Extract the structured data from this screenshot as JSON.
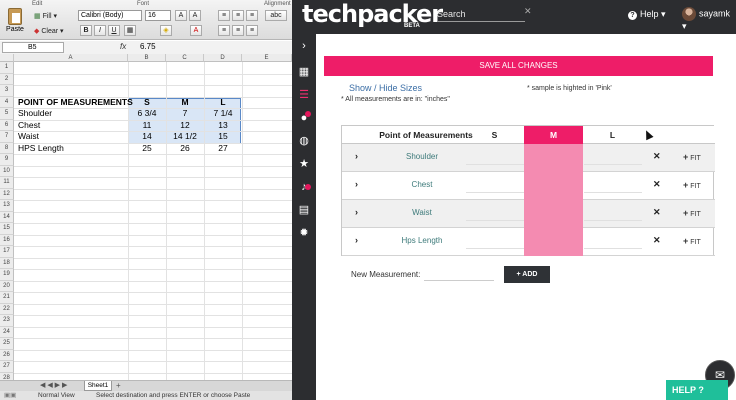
{
  "excel": {
    "ribbon": {
      "edit_label": "Edit",
      "font_label": "Font",
      "alignment_label": "Alignment",
      "paste_label": "Paste",
      "fill_label": "Fill",
      "clear_label": "Clear",
      "font_name": "Calibri (Body)",
      "font_size": "16",
      "wrap_label": "abc"
    },
    "formula_bar": {
      "name_box": "B5",
      "fx": "fx",
      "value": "6.75"
    },
    "columns": [
      "A",
      "B",
      "C",
      "D",
      "E"
    ],
    "rows": [
      "1",
      "2",
      "3",
      "4",
      "5",
      "6",
      "7",
      "8",
      "9",
      "10",
      "11",
      "12",
      "13",
      "14",
      "15",
      "16",
      "17",
      "18",
      "19",
      "20",
      "21",
      "22",
      "23",
      "24",
      "25",
      "26",
      "27",
      "28"
    ],
    "header": {
      "label": "POINT OF MEASUREMENTS",
      "sizes": [
        "S",
        "M",
        "L"
      ]
    },
    "data_rows": [
      {
        "label": "Shoulder",
        "values": [
          "6 3/4",
          "7",
          "7 1/4"
        ]
      },
      {
        "label": "Chest",
        "values": [
          "11",
          "12",
          "13"
        ]
      },
      {
        "label": "Waist",
        "values": [
          "14",
          "14 1/2",
          "15"
        ]
      },
      {
        "label": "HPS Length",
        "values": [
          "25",
          "26",
          "27"
        ]
      }
    ],
    "sheet_tab": "Sheet1",
    "status": {
      "view": "Normal View",
      "message": "Select destination and press ENTER or choose Paste"
    }
  },
  "app": {
    "logo": "techpacker",
    "beta": "BETA",
    "search_placeholder": "Search",
    "search_clear": "✕",
    "help_label": "Help ▾",
    "user_name": "sayamk ▾",
    "save_button": "SAVE ALL CHANGES",
    "show_hide": "Show / Hide Sizes",
    "note_inches": "* All measurements are in: \"inches\"",
    "note_sample": "* sample is highted in 'Pink'",
    "table_headers": [
      "Point of Measurements",
      "S",
      "M",
      "L"
    ],
    "rows": [
      {
        "label": "Shoulder"
      },
      {
        "label": "Chest"
      },
      {
        "label": "Waist"
      },
      {
        "label": "Hps Length"
      }
    ],
    "fit_label": "FIT",
    "new_measurement_label": "New Measurement:",
    "add_button": "+ ADD",
    "help_button": "HELP ?",
    "colors": {
      "accent": "#ee1d68",
      "sample": "#f48bb1",
      "dark": "#2c2d30",
      "help": "#1fbf9a"
    }
  }
}
